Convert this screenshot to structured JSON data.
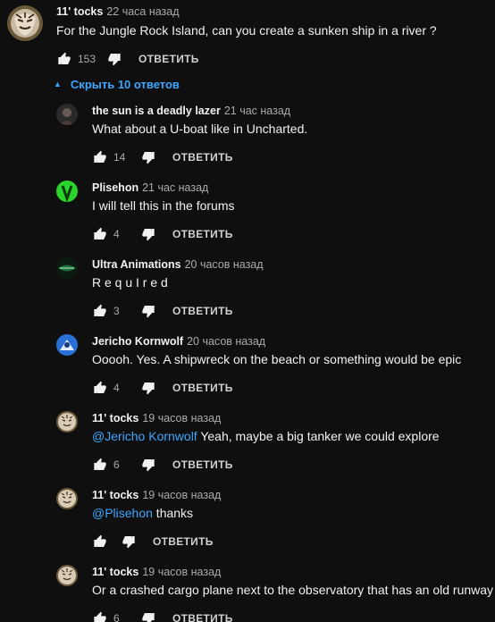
{
  "reply_label": "ОТВЕТИТЬ",
  "toggle_label": "Скрыть 10 ответов",
  "comments": [
    {
      "author": "11' tocks",
      "time": "22 часа назад",
      "text": "For the Jungle Rock Island, can you create a sunken ship in a river ?",
      "likes": "153"
    },
    {
      "author": "the sun is a deadly lazer",
      "time": "21 час назад",
      "text": "What about a U-boat like in Uncharted.",
      "likes": "14"
    },
    {
      "author": "Plisehon",
      "time": "21 час назад",
      "text": "I will tell this in the forums",
      "likes": "4"
    },
    {
      "author": "Ultra Animations",
      "time": "20 часов назад",
      "text": "R e q u I r e d",
      "likes": "3"
    },
    {
      "author": "Jericho Kornwolf",
      "time": "20 часов назад",
      "text": "Ooooh. Yes. A shipwreck on the beach or something would be epic",
      "likes": "4"
    },
    {
      "author": "11' tocks",
      "time": "19 часов назад",
      "mention": "@Jericho Kornwolf",
      "text": " Yeah, maybe a big tanker we could explore",
      "likes": "6"
    },
    {
      "author": "11' tocks",
      "time": "19 часов назад",
      "mention": "@Plisehon",
      "text": " thanks",
      "likes": ""
    },
    {
      "author": "11' tocks",
      "time": "19 часов назад",
      "text": "Or a crashed cargo plane next to the observatory that has an old runway",
      "likes": "6"
    }
  ],
  "icons": {
    "like": "thumb-up-icon",
    "dislike": "thumb-down-icon",
    "toggle": "caret-up-icon"
  },
  "colors": {
    "background": "#0f0f0f",
    "link": "#3ea6ff",
    "muted": "#aaaaaa"
  }
}
